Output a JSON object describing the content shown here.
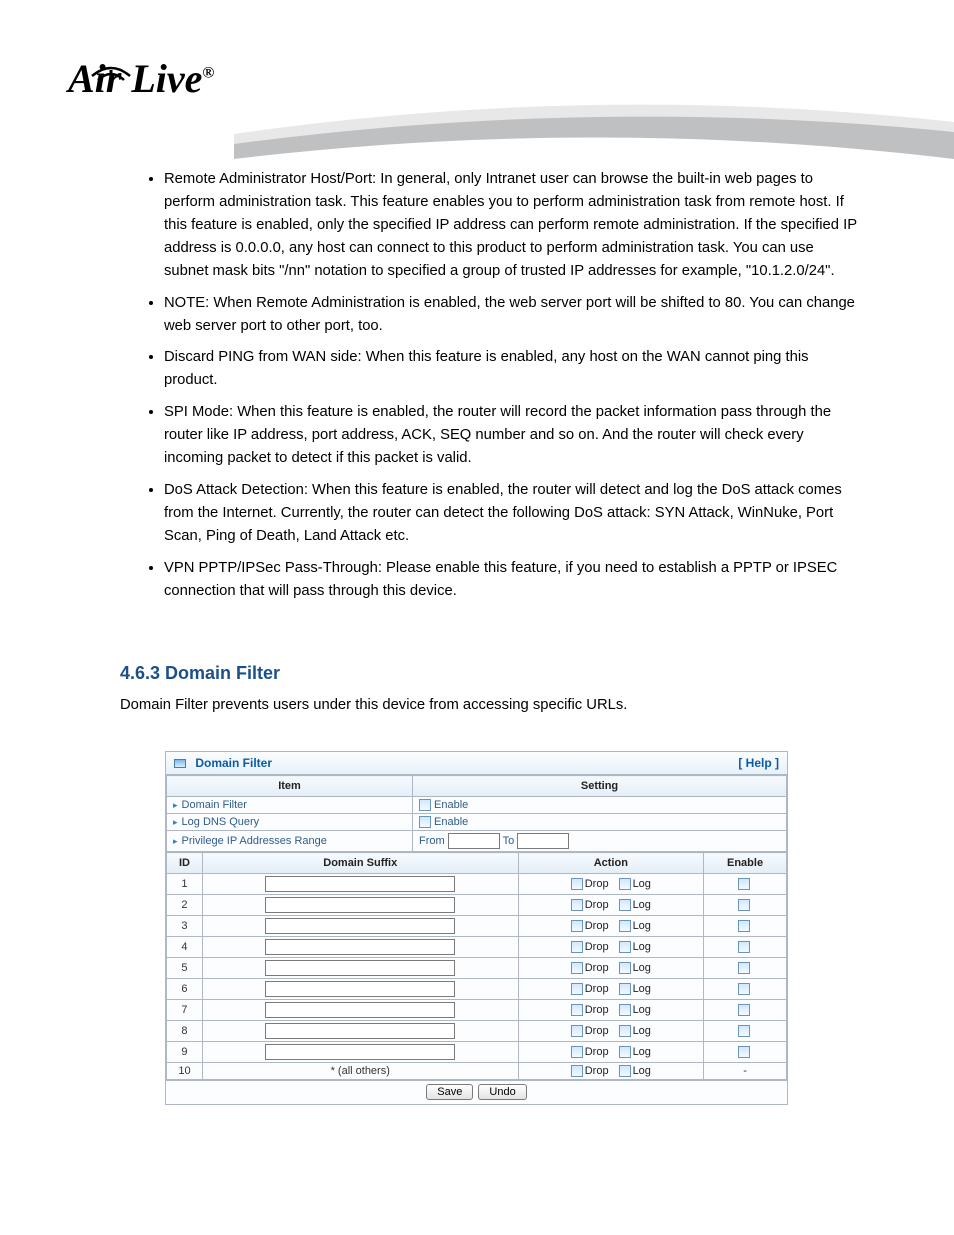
{
  "logo": {
    "text": "Air Live",
    "registered": "®"
  },
  "bullets": [
    "Remote Administrator Host/Port: In general, only Intranet user can browse the built-in web pages to perform administration task. This feature enables you to perform administration task from remote host. If this feature is enabled, only the specified IP address can perform remote administration. If the specified IP address is 0.0.0.0, any host can connect to this product to perform administration task. You can use subnet mask bits \"/nn\" notation to specified a group of trusted IP addresses for example, \"10.1.2.0/24\".",
    "NOTE: When Remote Administration is enabled, the web server port will be shifted to 80. You can change web server port to other port, too.",
    "Discard PING from WAN side: When this feature is enabled, any host on the WAN cannot ping this product.",
    "SPI Mode: When this feature is enabled, the router will record the packet information pass through the router like IP address, port address, ACK, SEQ number and so on. And the router will check every incoming packet to detect if this packet is valid.",
    "DoS Attack Detection: When this feature is enabled, the router will detect and log the DoS attack comes from the Internet. Currently, the router can detect the following DoS attack: SYN Attack, WinNuke, Port Scan, Ping of Death, Land Attack etc.",
    "VPN PPTP/IPSec Pass-Through: Please enable this feature, if you need to establish a PPTP or IPSEC connection that will pass through this device."
  ],
  "section": {
    "heading": "4.6.3 Domain Filter",
    "paragraph": "Domain Filter prevents users under this device from accessing specific URLs."
  },
  "panel": {
    "title": "Domain Filter",
    "help": "[ Help ]",
    "headers": {
      "item": "Item",
      "setting": "Setting"
    },
    "items": {
      "domainFilter": {
        "label": "Domain Filter",
        "enable": "Enable"
      },
      "logDns": {
        "label": "Log DNS Query",
        "enable": "Enable"
      },
      "privIp": {
        "label": "Privilege IP Addresses Range",
        "from": "From",
        "to": "To"
      }
    },
    "ruleHeaders": {
      "id": "ID",
      "suffix": "Domain Suffix",
      "action": "Action",
      "enable": "Enable"
    },
    "actionLabels": {
      "drop": "Drop",
      "log": "Log"
    },
    "rows": [
      {
        "id": "1",
        "suffix": "",
        "allOthers": false,
        "enableDisabled": false
      },
      {
        "id": "2",
        "suffix": "",
        "allOthers": false,
        "enableDisabled": false
      },
      {
        "id": "3",
        "suffix": "",
        "allOthers": false,
        "enableDisabled": false
      },
      {
        "id": "4",
        "suffix": "",
        "allOthers": false,
        "enableDisabled": false
      },
      {
        "id": "5",
        "suffix": "",
        "allOthers": false,
        "enableDisabled": false
      },
      {
        "id": "6",
        "suffix": "",
        "allOthers": false,
        "enableDisabled": false
      },
      {
        "id": "7",
        "suffix": "",
        "allOthers": false,
        "enableDisabled": false
      },
      {
        "id": "8",
        "suffix": "",
        "allOthers": false,
        "enableDisabled": false
      },
      {
        "id": "9",
        "suffix": "",
        "allOthers": false,
        "enableDisabled": false
      },
      {
        "id": "10",
        "suffix": "* (all others)",
        "allOthers": true,
        "enableDisabled": true
      }
    ],
    "buttons": {
      "save": "Save",
      "undo": "Undo"
    }
  }
}
